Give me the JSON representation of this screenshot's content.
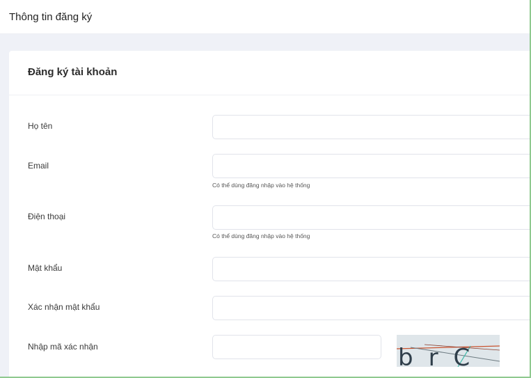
{
  "header": {
    "title": "Thông tin đăng ký"
  },
  "card": {
    "title": "Đăng ký tài khoản"
  },
  "form": {
    "fields": [
      {
        "label": "Họ tên",
        "value": "",
        "placeholder": ""
      },
      {
        "label": "Email",
        "value": "",
        "placeholder": "",
        "hint": "Có thể dùng đăng nhập vào hệ thống"
      },
      {
        "label": "Điện thoại",
        "value": "",
        "placeholder": "",
        "hint": "Có thể dùng đăng nhập vào hệ thống"
      },
      {
        "label": "Mật khẩu",
        "value": "",
        "placeholder": ""
      },
      {
        "label": "Xác nhận mật khẩu",
        "value": "",
        "placeholder": ""
      },
      {
        "label": "Nhập mã xác nhận",
        "value": "",
        "placeholder": ""
      }
    ],
    "captcha_text": "brC"
  },
  "colors": {
    "page_background": "#eff1f7",
    "card_background": "#ffffff",
    "input_border": "#e1e3ea",
    "frame_edge": "#8fc98f"
  }
}
